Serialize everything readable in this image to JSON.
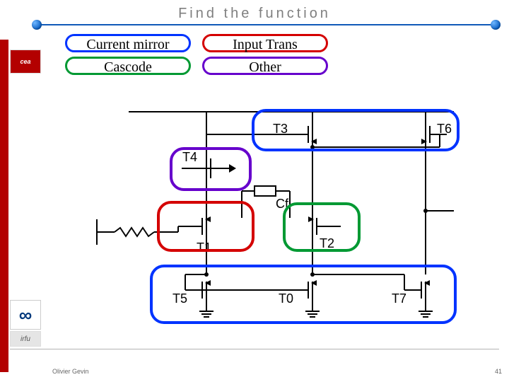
{
  "title": "Find the function",
  "footer": {
    "author": "Olivier Gevin",
    "page": "41"
  },
  "legend": {
    "current_mirror": "Current mirror",
    "input_trans": "Input Trans",
    "cascode": "Cascode",
    "other": "Other"
  },
  "logos": {
    "cea": "cea",
    "irfu": "irfu",
    "infinity": "∞"
  },
  "circuit": {
    "labels": {
      "T0": "T0",
      "T1": "T1",
      "T2": "T2",
      "T3": "T3",
      "T4": "T4",
      "T5": "T5",
      "T6": "T6",
      "T7": "T7",
      "Cf": "Cf"
    }
  }
}
